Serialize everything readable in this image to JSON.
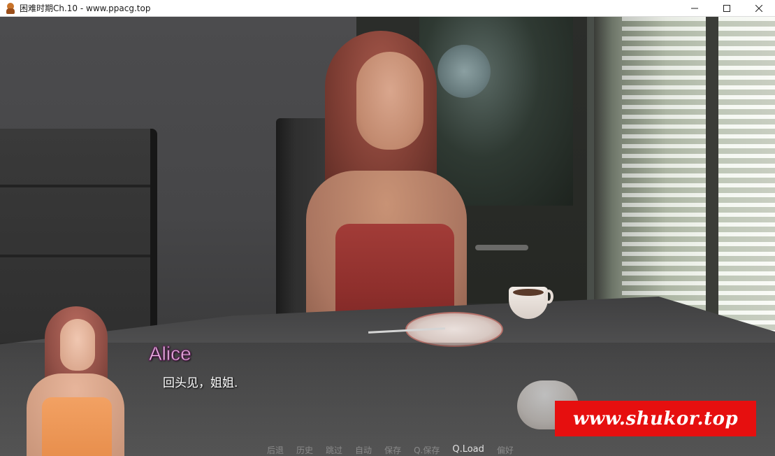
{
  "window": {
    "title": "困难时期Ch.10 - www.ppacg.top",
    "icon": "character-app-icon"
  },
  "dialogue": {
    "speaker": "Alice",
    "text": "回头见，姐姐.",
    "speaker_color": "#f7c6f0"
  },
  "quick_menu": {
    "items": [
      "后退",
      "历史",
      "跳过",
      "自动",
      "保存",
      "Q.保存",
      "Q.Load",
      "偏好"
    ]
  },
  "watermark": {
    "text": "www.shukor.top",
    "color": "#e60f0f"
  }
}
